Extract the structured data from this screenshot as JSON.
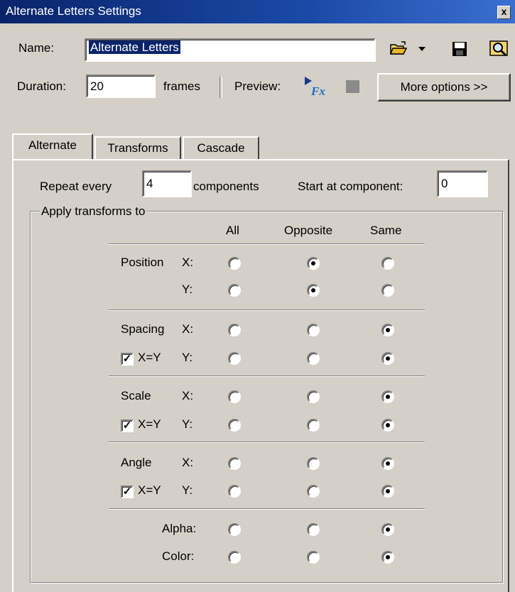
{
  "window": {
    "title": "Alternate Letters Settings",
    "close_glyph": "x"
  },
  "header": {
    "name_label": "Name:",
    "name_value": "Alternate Letters",
    "duration_label": "Duration:",
    "duration_value": "20",
    "frames_label": "frames",
    "preview_label": "Preview:",
    "more_options": "More options >>",
    "icons": [
      "open-folder-icon",
      "dropdown-arrow-icon",
      "save-icon",
      "browse-icon",
      "preview-play-icon",
      "stop-icon"
    ]
  },
  "tabs": [
    {
      "label": "Alternate",
      "active": true
    },
    {
      "label": "Transforms",
      "active": false
    },
    {
      "label": "Cascade",
      "active": false
    }
  ],
  "alternate": {
    "repeat_label": "Repeat every",
    "repeat_value": "4",
    "components_label": "components",
    "start_label": "Start at component:",
    "start_value": "0",
    "group_label": "Apply transforms to",
    "columns": [
      "All",
      "Opposite",
      "Same"
    ],
    "rows": [
      {
        "label": "Position",
        "axis": "X:",
        "selected": "Opposite"
      },
      {
        "label": "",
        "axis": "Y:",
        "selected": "Opposite"
      },
      {
        "label": "Spacing",
        "axis": "X:",
        "selected": "Same"
      },
      {
        "label": "X=Y",
        "axis": "Y:",
        "checkbox": true,
        "selected": "Same"
      },
      {
        "label": "Scale",
        "axis": "X:",
        "selected": "Same"
      },
      {
        "label": "X=Y",
        "axis": "Y:",
        "checkbox": true,
        "selected": "Same"
      },
      {
        "label": "Angle",
        "axis": "X:",
        "selected": "Same"
      },
      {
        "label": "X=Y",
        "axis": "Y:",
        "checkbox": true,
        "selected": "Same"
      },
      {
        "label": "",
        "axis": "Alpha:",
        "selected": "Same"
      },
      {
        "label": "",
        "axis": "Color:",
        "selected": "Same"
      }
    ]
  },
  "colors": {
    "title_bar": "#0a246a",
    "face": "#d4d0c8",
    "selection": "#0a246a"
  }
}
